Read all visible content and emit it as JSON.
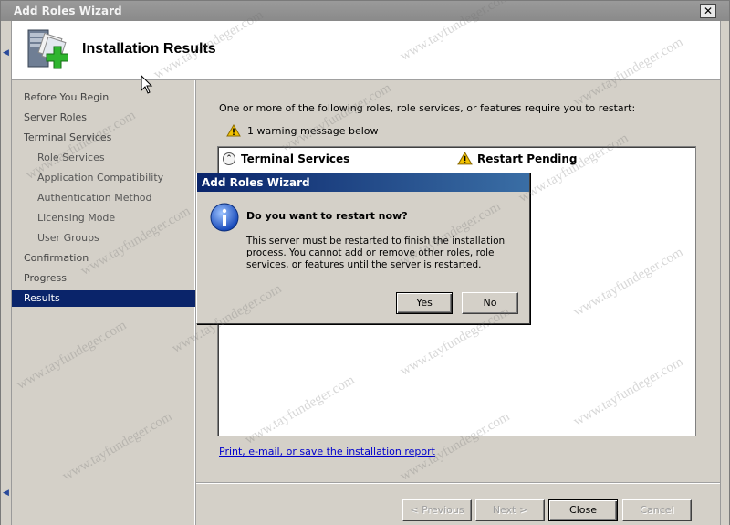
{
  "window": {
    "title": "Add Roles Wizard",
    "close_glyph": "✕"
  },
  "header": {
    "title": "Installation Results",
    "icon": "server-roles-add-icon"
  },
  "nav": {
    "items": [
      {
        "label": "Before You Begin",
        "level": 0,
        "active": false
      },
      {
        "label": "Server Roles",
        "level": 0,
        "active": false
      },
      {
        "label": "Terminal Services",
        "level": 0,
        "active": false
      },
      {
        "label": "Role Services",
        "level": 1,
        "active": false
      },
      {
        "label": "Application Compatibility",
        "level": 1,
        "active": false
      },
      {
        "label": "Authentication Method",
        "level": 1,
        "active": false
      },
      {
        "label": "Licensing Mode",
        "level": 1,
        "active": false
      },
      {
        "label": "User Groups",
        "level": 1,
        "active": false
      },
      {
        "label": "Confirmation",
        "level": 0,
        "active": false
      },
      {
        "label": "Progress",
        "level": 0,
        "active": false
      },
      {
        "label": "Results",
        "level": 0,
        "active": true
      }
    ]
  },
  "main": {
    "intro": "One or more of the following roles, role services, or features require you to restart:",
    "warning_summary": "1 warning message below",
    "results": [
      {
        "role": "Terminal Services",
        "status": "Restart Pending",
        "status_icon": "warning-icon"
      }
    ],
    "report_link": "Print, e-mail, or save the installation report"
  },
  "footer": {
    "previous": "< Previous",
    "next": "Next >",
    "close": "Close",
    "cancel": "Cancel"
  },
  "dialog": {
    "title": "Add Roles Wizard",
    "heading": "Do you want to restart now?",
    "body": "This server must be restarted to finish the installation process. You cannot add or remove other roles, role services, or features until the server is restarted.",
    "yes": "Yes",
    "no": "No",
    "icon": "info-icon"
  },
  "watermark": {
    "text": "www.tayfundeger.com"
  },
  "colors": {
    "selection": "#0a246a",
    "link": "#0000cc",
    "warning": "#f2c200"
  }
}
